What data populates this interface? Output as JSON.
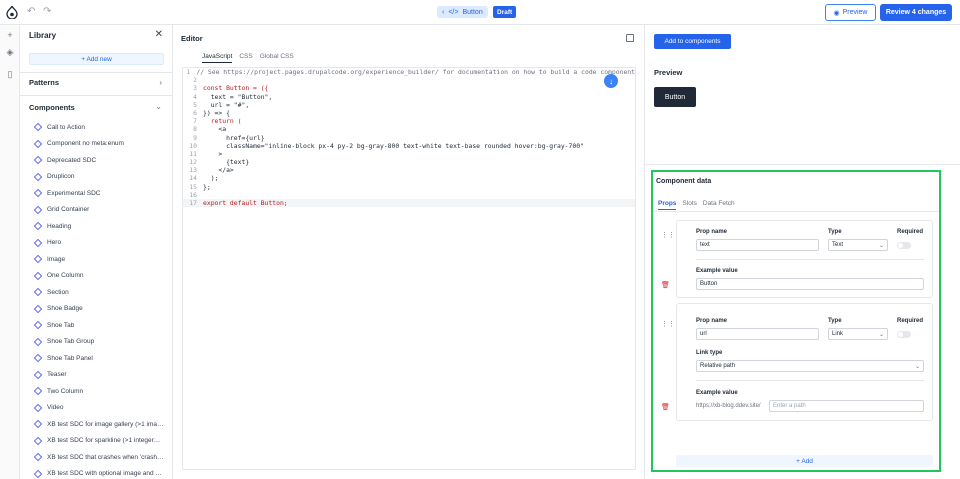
{
  "topbar": {
    "component_name": "Button",
    "status_badge": "Draft",
    "preview_label": "Preview",
    "review_label": "Review 4 changes"
  },
  "library": {
    "title": "Library",
    "add_new_label": "+ Add new",
    "patterns_label": "Patterns",
    "components_label": "Components",
    "items": [
      "Call to Action",
      "Component no meta:enum",
      "Deprecated SDC",
      "Druplicon",
      "Experimental SDC",
      "Grid Container",
      "Heading",
      "Hero",
      "Image",
      "One Column",
      "Section",
      "Shoe Badge",
      "Shoe Tab",
      "Shoe Tab Group",
      "Shoe Tab Panel",
      "Teaser",
      "Two Column",
      "Video",
      "XB test SDC for image gallery (>1 ima…",
      "XB test SDC for sparkline (>1 integer…",
      "XB test SDC that crashes when 'crash…",
      "XB test SDC with optional image and …"
    ]
  },
  "editor": {
    "title": "Editor",
    "tabs": [
      "JavaScript",
      "CSS",
      "Global CSS"
    ],
    "active_tab": "JavaScript",
    "lines": [
      "// See https://project.pages.drupalcode.org/experience_builder/ for documentation on how to build a code component",
      "",
      "const Button = ({",
      "  text = \"Button\",",
      "  url = \"#\",",
      "}) => {",
      "  return (",
      "    <a",
      "      href={url}",
      "      className=\"inline-block px-4 py-2 bg-gray-800 text-white text-base rounded hover:bg-gray-700\"",
      "    >",
      "      {text}",
      "    </a>",
      "  );",
      "};",
      "",
      "export default Button;"
    ],
    "line_numbers": [
      "1",
      "2",
      "3",
      "4",
      "5",
      "6",
      "7",
      "8",
      "9",
      "10",
      "11",
      "12",
      "13",
      "14",
      "15",
      "16",
      "17"
    ]
  },
  "right": {
    "add_to_components_label": "Add to components",
    "preview_title": "Preview",
    "preview_button_label": "Button",
    "component_data_title": "Component data",
    "tabs": [
      "Props",
      "Slots",
      "Data Fetch"
    ],
    "props": [
      {
        "prop_name_label": "Prop name",
        "prop_name": "text",
        "type_label": "Type",
        "type": "Text",
        "required_label": "Required",
        "example_label": "Example value",
        "example": "Button"
      },
      {
        "prop_name_label": "Prop name",
        "prop_name": "url",
        "type_label": "Type",
        "type": "Link",
        "required_label": "Required",
        "link_type_label": "Link type",
        "link_type": "Relative path",
        "example_label": "Example value",
        "example_prefix": "https://xb-blog.ddev.site/",
        "example_placeholder": "Enter a path"
      }
    ],
    "add_prop_label": "+ Add"
  },
  "colors": {
    "accent": "#2563eb",
    "highlight": "#22c55e"
  }
}
